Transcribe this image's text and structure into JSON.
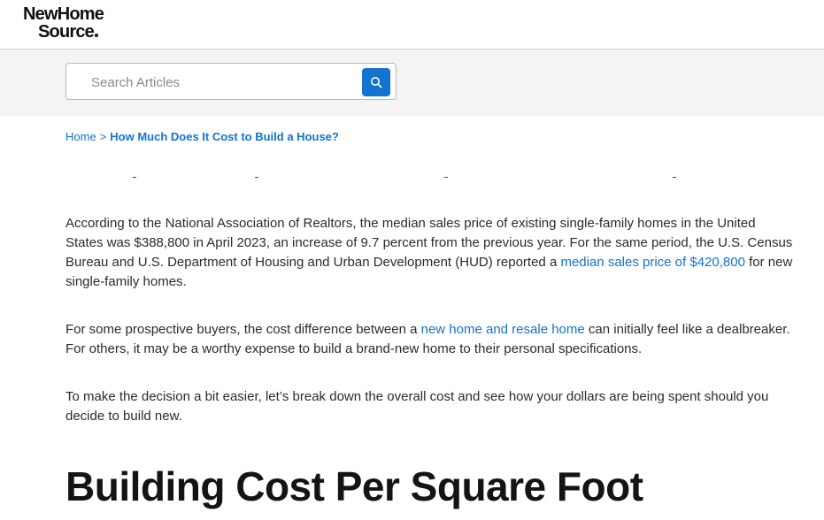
{
  "brand": {
    "line1": "NewHome",
    "line2": "Source"
  },
  "search": {
    "placeholder": "Search Articles",
    "button_icon": "search-icon"
  },
  "breadcrumb": {
    "home": "Home",
    "separator": ">",
    "current": "How Much Does It Cost to Build a House?"
  },
  "article": {
    "p1_a": "According to the National Association of Realtors, the median sales price of existing single-family homes in the United States was $388,800 in April 2023, an increase of 9.7 percent from the previous year. For the same period, the U.S. Census Bureau and U.S. Department of Housing and Urban Development (HUD) reported a ",
    "p1_link": "median sales price of $420,800",
    "p1_b": " for new single-family homes.",
    "p2_a": "For some prospective buyers, the cost difference between a ",
    "p2_link": "new home and resale home",
    "p2_b": " can initially feel like a dealbreaker. For others, it may be a worthy expense to build a brand-new home to their personal specifications.",
    "p3": "To make the decision a bit easier, let’s break down the overall cost and see how your dollars are being spent should you decide to build new.",
    "heading": "Building Cost Per Square Foot"
  },
  "colors": {
    "link": "#1273d1",
    "search_button": "#1273d1",
    "search_band": "#f4f4f4"
  }
}
